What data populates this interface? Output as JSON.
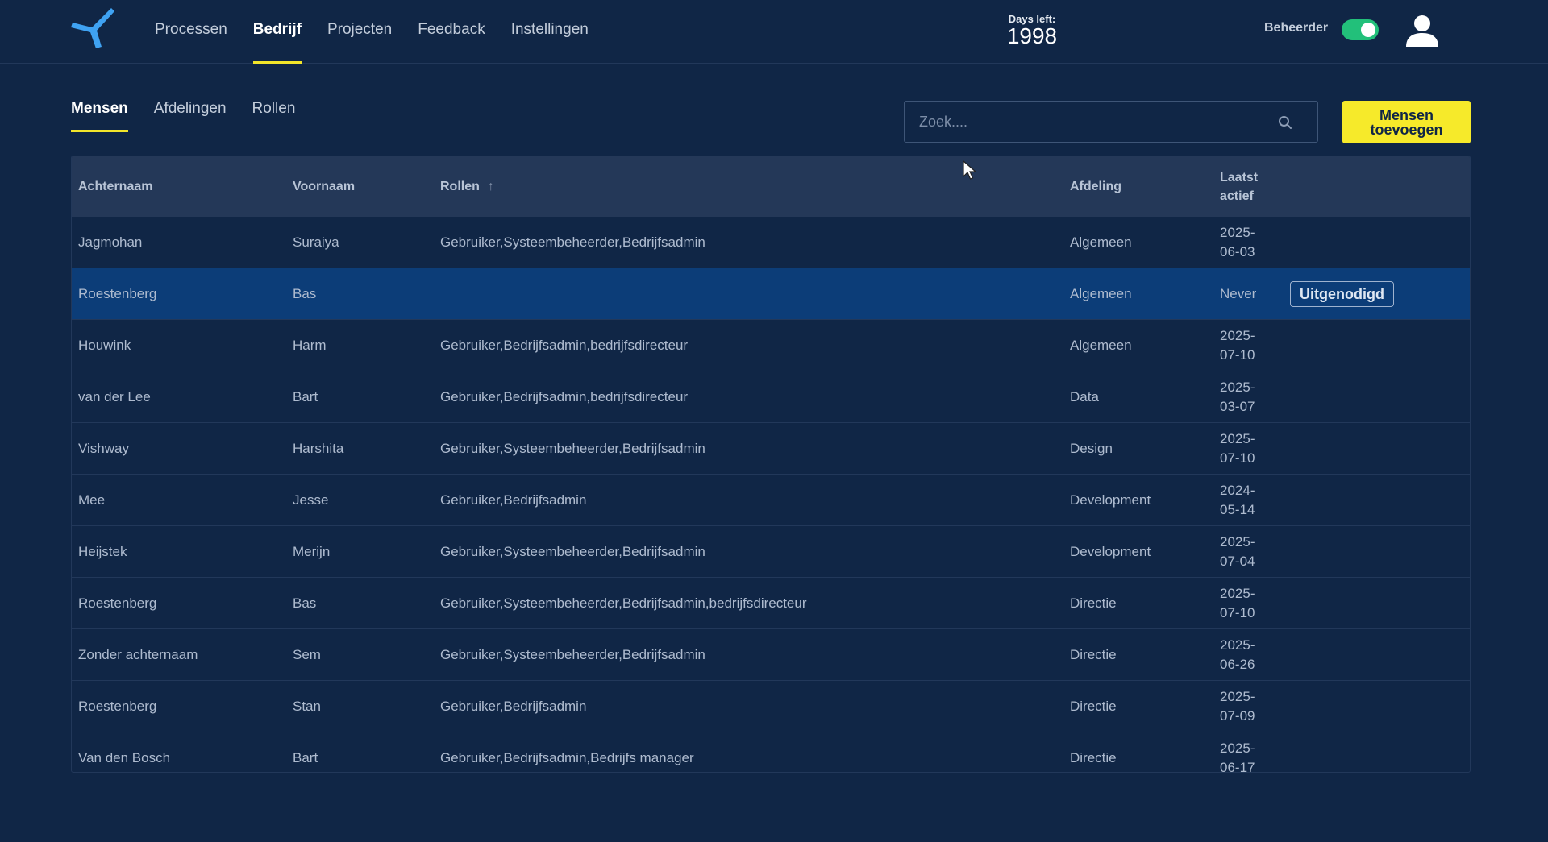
{
  "nav": {
    "items": [
      {
        "label": "Processen",
        "active": false
      },
      {
        "label": "Bedrijf",
        "active": true
      },
      {
        "label": "Projecten",
        "active": false
      },
      {
        "label": "Feedback",
        "active": false
      },
      {
        "label": "Instellingen",
        "active": false
      }
    ]
  },
  "header": {
    "days_left_label": "Days left:",
    "days_left_value": "1998",
    "role_label": "Beheerder",
    "role_toggle_on": true,
    "logo_icon": "logo-icon",
    "user_icon": "user-icon"
  },
  "subtabs": [
    {
      "label": "Mensen",
      "active": true
    },
    {
      "label": "Afdelingen",
      "active": false
    },
    {
      "label": "Rollen",
      "active": false
    }
  ],
  "search": {
    "placeholder": "Zoek...."
  },
  "add_button": {
    "label": "Mensen toevoegen"
  },
  "colors": {
    "accent": "#f6ea2a",
    "toggle": "#22c07a",
    "selected_row": "#0c3d78",
    "background": "#102646"
  },
  "table": {
    "headers": {
      "last_name": "Achternaam",
      "first_name": "Voornaam",
      "roles": "Rollen",
      "department": "Afdeling",
      "last_active": "Laatst actief"
    },
    "sort_icon": "arrow-up-icon",
    "rows": [
      {
        "last_name": "Jagmohan",
        "first_name": "Suraiya",
        "roles": "Gebruiker,Systeembeheerder,Bedrijfsadmin",
        "department": "Algemeen",
        "last_active": "2025-06-03",
        "badge": ""
      },
      {
        "last_name": "Roestenberg",
        "first_name": "Bas",
        "roles": "",
        "department": "Algemeen",
        "last_active": "Never",
        "badge": "Uitgenodigd",
        "selected": true
      },
      {
        "last_name": "Houwink",
        "first_name": "Harm",
        "roles": "Gebruiker,Bedrijfsadmin,bedrijfsdirecteur",
        "department": "Algemeen",
        "last_active": "2025-07-10",
        "badge": ""
      },
      {
        "last_name": "van der Lee",
        "first_name": "Bart",
        "roles": "Gebruiker,Bedrijfsadmin,bedrijfsdirecteur",
        "department": "Data",
        "last_active": "2025-03-07",
        "badge": ""
      },
      {
        "last_name": "Vishway",
        "first_name": "Harshita",
        "roles": "Gebruiker,Systeembeheerder,Bedrijfsadmin",
        "department": "Design",
        "last_active": "2025-07-10",
        "badge": ""
      },
      {
        "last_name": "Mee",
        "first_name": "Jesse",
        "roles": "Gebruiker,Bedrijfsadmin",
        "department": "Development",
        "last_active": "2024-05-14",
        "badge": ""
      },
      {
        "last_name": "Heijstek",
        "first_name": "Merijn",
        "roles": "Gebruiker,Systeembeheerder,Bedrijfsadmin",
        "department": "Development",
        "last_active": "2025-07-04",
        "badge": ""
      },
      {
        "last_name": "Roestenberg",
        "first_name": "Bas",
        "roles": "Gebruiker,Systeembeheerder,Bedrijfsadmin,bedrijfsdirecteur",
        "department": "Directie",
        "last_active": "2025-07-10",
        "badge": ""
      },
      {
        "last_name": "Zonder achternaam",
        "first_name": "Sem",
        "roles": "Gebruiker,Systeembeheerder,Bedrijfsadmin",
        "department": "Directie",
        "last_active": "2025-06-26",
        "badge": ""
      },
      {
        "last_name": "Roestenberg",
        "first_name": "Stan",
        "roles": "Gebruiker,Bedrijfsadmin",
        "department": "Directie",
        "last_active": "2025-07-09",
        "badge": ""
      },
      {
        "last_name": "Van den Bosch",
        "first_name": "Bart",
        "roles": "Gebruiker,Bedrijfsadmin,Bedrijfs manager",
        "department": "Directie",
        "last_active": "2025-06-17",
        "badge": ""
      }
    ]
  }
}
